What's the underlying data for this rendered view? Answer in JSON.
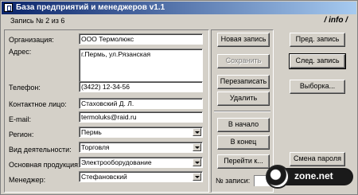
{
  "window": {
    "title": "База предприятий и менеджеров v1.1"
  },
  "status": {
    "record_text": "Запись № 2 из 6",
    "info_link": "/ info /"
  },
  "form": {
    "org_label": "Организация:",
    "org_value": "ООО Термолюкс",
    "address_label": "Адрес:",
    "address_value": "г.Пермь, ул.Рязанская",
    "phone_label": "Телефон:",
    "phone_value": "(3422) 12-34-56",
    "contact_label": "Контактное лицо:",
    "contact_value": "Стаховский Д. Л.",
    "email_label": "E-mail:",
    "email_value": "termoluks@raid.ru",
    "region_label": "Регион:",
    "region_value": "Пермь",
    "activity_label": "Вид деятельности:",
    "activity_value": "Торговля",
    "product_label": "Основная продукция:",
    "product_value": "Электрооборудование",
    "manager_label": "Менеджер:",
    "manager_value": "Стефановский"
  },
  "buttons": {
    "new_record": "Новая запись",
    "save": "Сохранить",
    "rewrite": "Перезаписать",
    "delete": "Удалить",
    "to_start": "В начало",
    "to_end": "В конец",
    "goto": "Перейти к...",
    "prev": "Пред. запись",
    "next": "След. запись",
    "select": "Выборка...",
    "change_password": "Смена пароля"
  },
  "goto": {
    "label": "№ записи:",
    "value": ""
  },
  "watermark": {
    "text": "zone.net"
  }
}
